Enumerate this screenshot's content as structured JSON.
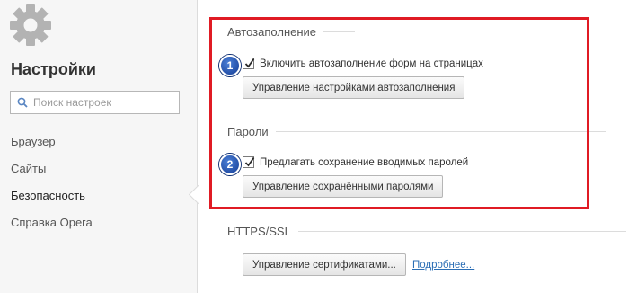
{
  "sidebar": {
    "gear_icon": "gear-icon",
    "title": "Настройки",
    "search": {
      "placeholder": "Поиск настроек",
      "value": "",
      "icon": "search-icon"
    },
    "items": [
      {
        "label": "Браузер",
        "active": false
      },
      {
        "label": "Сайты",
        "active": false
      },
      {
        "label": "Безопасность",
        "active": true
      },
      {
        "label": "Справка Opera",
        "active": false
      }
    ]
  },
  "autofill": {
    "title": "Автозаполнение",
    "checkbox_label": "Включить автозаполнение форм на страницах",
    "checked": true,
    "button_label": "Управление настройками автозаполнения"
  },
  "passwords": {
    "title": "Пароли",
    "checkbox_label": "Предлагать сохранение вводимых паролей",
    "checked": true,
    "button_label": "Управление сохранёнными паролями"
  },
  "https": {
    "title": "HTTPS/SSL",
    "button_label": "Управление сертификатами...",
    "link_label": "Подробнее..."
  },
  "annotations": {
    "badge_1": "1",
    "badge_2": "2",
    "highlight_color": "#e01b24",
    "badge_color": "#1f4fb0"
  }
}
